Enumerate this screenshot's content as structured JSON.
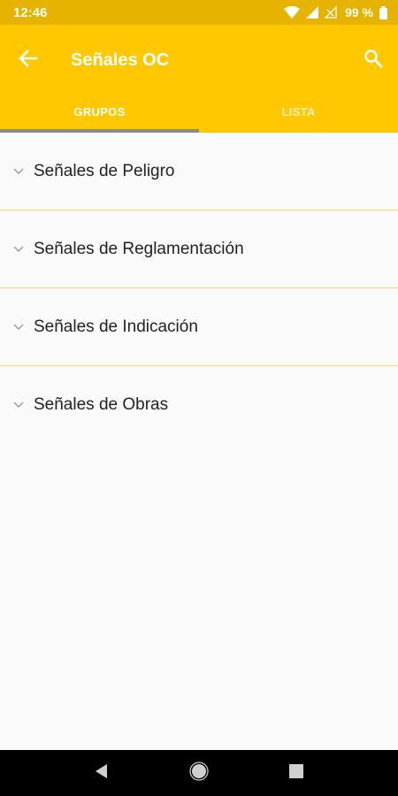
{
  "status_bar": {
    "time": "12:46",
    "battery": "99 %",
    "icons": [
      "wifi-icon",
      "signal-icon",
      "signal-empty-icon",
      "battery-icon"
    ]
  },
  "app_bar": {
    "title": "Señales OC",
    "back_icon": "arrow-back-icon",
    "search_icon": "search-icon",
    "background_color": "#ffc800"
  },
  "tabs": [
    {
      "label": "GRUPOS",
      "selected": true
    },
    {
      "label": "LISTA",
      "selected": false
    }
  ],
  "groups": [
    {
      "label": "Señales de Peligro"
    },
    {
      "label": "Señales de Reglamentación"
    },
    {
      "label": "Señales de Indicación"
    },
    {
      "label": "Señales de Obras"
    }
  ],
  "nav_bar": {
    "icons": [
      "back-triangle-icon",
      "home-circle-icon",
      "recents-square-icon"
    ]
  }
}
